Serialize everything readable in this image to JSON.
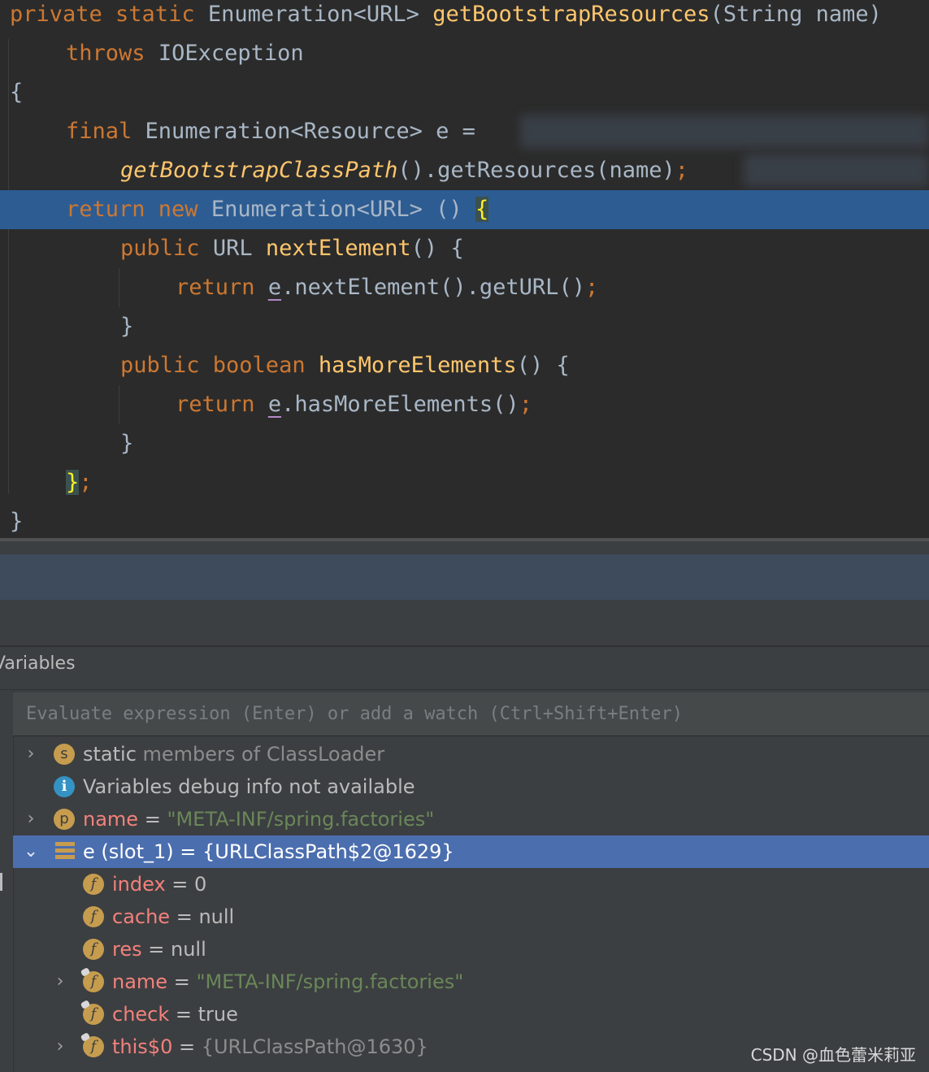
{
  "editor": {
    "l1": {
      "kw": "private static",
      "type": "Enumeration<URL>",
      "fn": "getBootstrapResources",
      "rest": "(String name)"
    },
    "l2": {
      "kw": "throws",
      "rest": "IOException"
    },
    "l3": {
      "text": "{"
    },
    "l4": {
      "kw": "final",
      "rest": "Enumeration<Resource> e ="
    },
    "l5": {
      "fn": "getBootstrapClassPath",
      "rest": "().getResources(name)",
      "semi": ";"
    },
    "l6": {
      "kw": "return new",
      "rest": "Enumeration<URL> ()",
      "brace": "{"
    },
    "l7": {
      "kw": "public",
      "type": "URL",
      "fn": "nextElement",
      "rest": "() {"
    },
    "l8": {
      "kw": "return",
      "var": "e",
      "rest": ".nextElement().getURL()",
      "semi": ";"
    },
    "l9": {
      "text": "}"
    },
    "l10": {
      "kw": "public boolean",
      "fn": "hasMoreElements",
      "rest": "() {"
    },
    "l11": {
      "kw": "return",
      "var": "e",
      "rest": ".hasMoreElements()",
      "semi": ";"
    },
    "l12": {
      "text": "}"
    },
    "l13": {
      "brace": "}",
      "semi": ";"
    },
    "l14": {
      "text": "}"
    }
  },
  "panel": {
    "title": "Variables",
    "eval_placeholder": "Evaluate expression (Enter) or add a watch (Ctrl+Shift+Enter)"
  },
  "vars": {
    "r1": {
      "chev": "›",
      "icon": "s",
      "label": "static",
      "rest": " members of ClassLoader"
    },
    "r2": {
      "icon": "i",
      "label": "Variables debug info not available"
    },
    "r3": {
      "chev": "›",
      "icon": "p",
      "name": "name",
      "eq": " = ",
      "value": "\"META-INF/spring.factories\""
    },
    "r4": {
      "chev": "⌄",
      "name": "e (slot_1)",
      "eq": " = ",
      "value": "{URLClassPath$2@1629}"
    },
    "r5": {
      "icon": "f",
      "name": "index",
      "eq": " = ",
      "value": "0"
    },
    "r6": {
      "icon": "f",
      "name": "cache",
      "eq": " = ",
      "value": "null"
    },
    "r7": {
      "icon": "f",
      "name": "res",
      "eq": " = ",
      "value": "null"
    },
    "r8": {
      "chev": "›",
      "icon": "f",
      "name": "name",
      "eq": " = ",
      "value": "\"META-INF/spring.factories\""
    },
    "r9": {
      "icon": "f",
      "name": "check",
      "eq": " = ",
      "value": "true"
    },
    "r10": {
      "chev": "›",
      "icon": "f",
      "name": "this$0",
      "eq": " = ",
      "value": "{URLClassPath@1630}"
    }
  },
  "watermark": "CSDN @血色蕾米莉亚",
  "colors": {
    "keyword": "#cc7832",
    "function": "#ffc66d",
    "plain": "#a9b7c6",
    "string": "#6a8759",
    "selection": "#2d5c93",
    "tree_selection": "#4b6eaf"
  }
}
